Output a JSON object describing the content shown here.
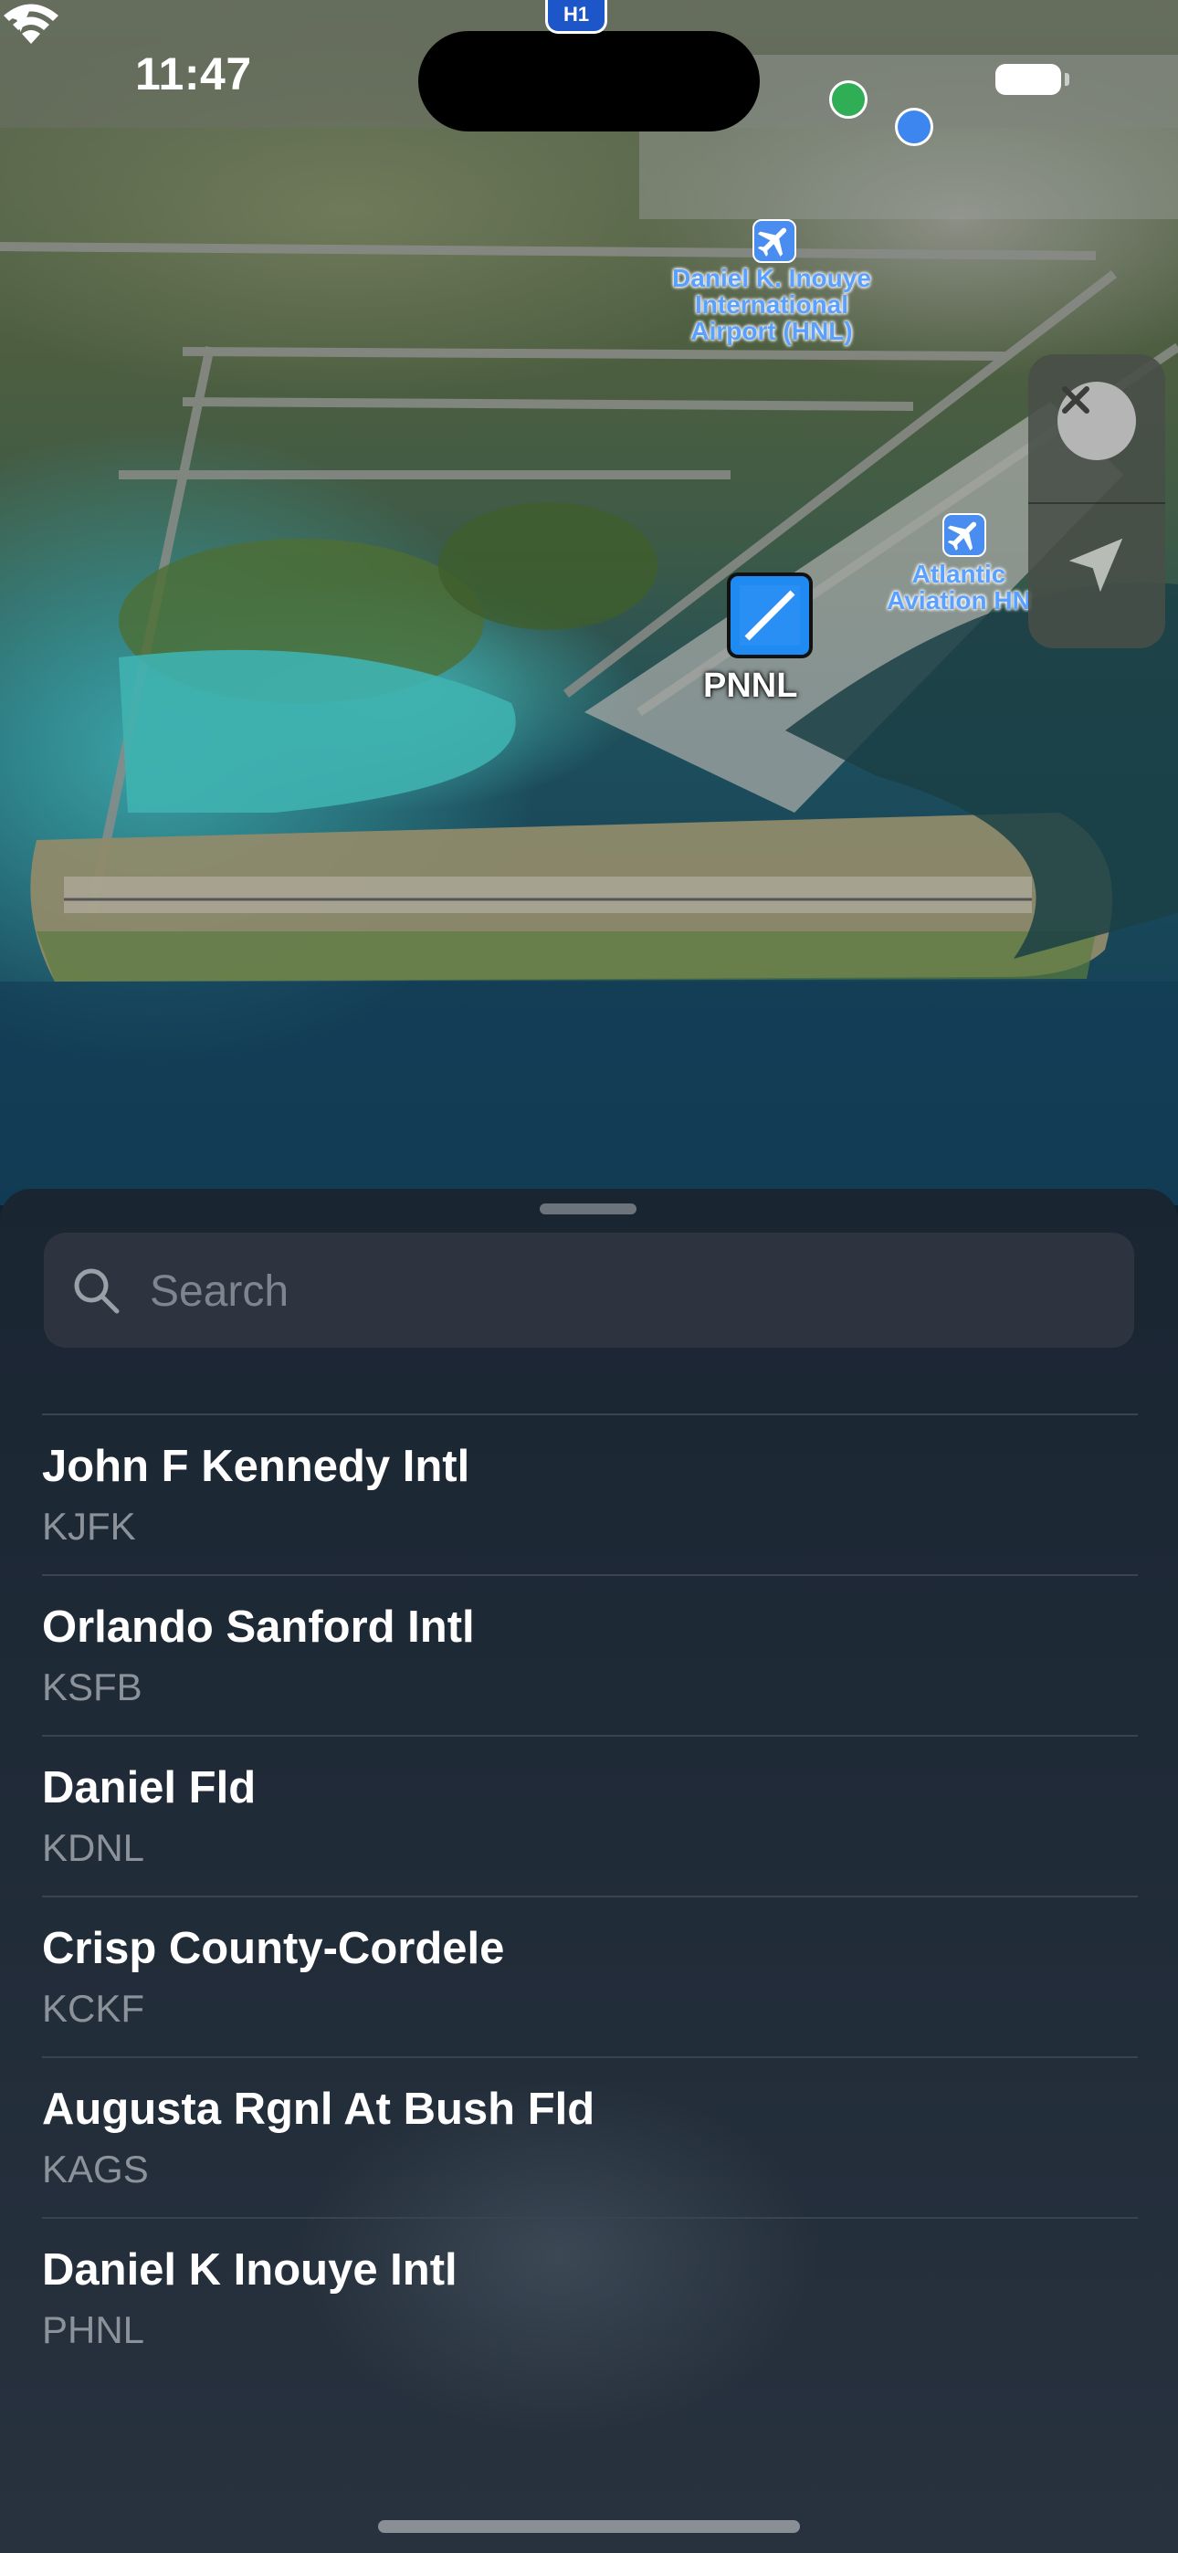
{
  "status_bar": {
    "time": "11:47"
  },
  "map": {
    "highway_shield": "H1",
    "airport_label": "Daniel K. Inouye International Airport (HNL)",
    "airport_label_lines": [
      "Daniel K. Inouye",
      "International",
      "Airport (HNL)"
    ],
    "atlantic_label_lines": [
      "Atlantic",
      "Aviation HN"
    ],
    "selected_marker_label": "PNNL"
  },
  "controls": {
    "close_icon": "close-icon",
    "locate_icon": "location-arrow-icon"
  },
  "search": {
    "placeholder": "Search",
    "value": ""
  },
  "results": [
    {
      "name": "John F Kennedy Intl",
      "code": "KJFK"
    },
    {
      "name": "Orlando Sanford Intl",
      "code": "KSFB"
    },
    {
      "name": "Daniel Fld",
      "code": "KDNL"
    },
    {
      "name": "Crisp County-Cordele",
      "code": "KCKF"
    },
    {
      "name": "Augusta Rgnl At Bush Fld",
      "code": "KAGS"
    },
    {
      "name": "Daniel K Inouye Intl",
      "code": "PHNL"
    }
  ],
  "colors": {
    "accent": "#1f8bf2",
    "sheet_bg": "#1f2a37",
    "text_secondary": "#8c929a"
  }
}
